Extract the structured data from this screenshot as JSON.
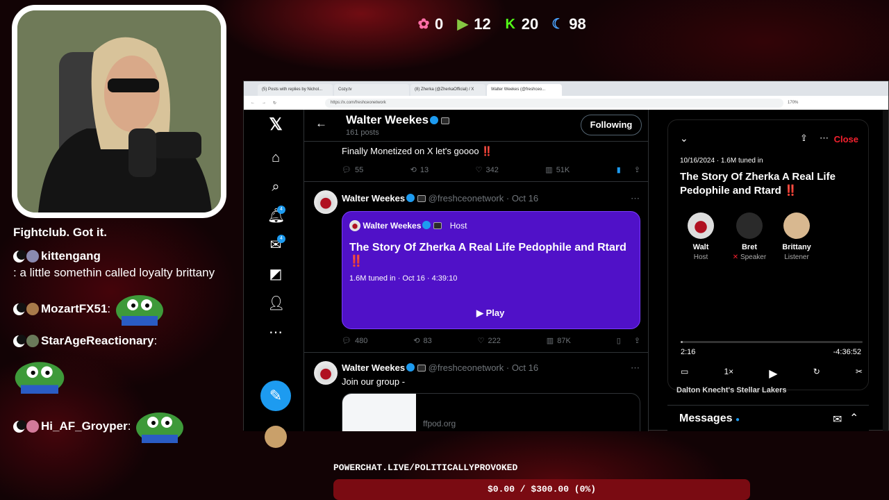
{
  "stream": {
    "counters": [
      {
        "icon": "flower-icon",
        "value": "0",
        "color": "#ff6fa8"
      },
      {
        "icon": "rumble-icon",
        "value": "12",
        "color": "#85c742"
      },
      {
        "icon": "kick-icon",
        "value": "20",
        "color": "#53fc18"
      },
      {
        "icon": "moon-icon",
        "value": "98",
        "color": "#4aa3ff"
      }
    ],
    "powerchat_label": "POWERCHAT.LIVE/POLITICALLYPROVOKED",
    "donation_text": "$0.00 / $300.00 (0%)",
    "donation_progress": 0
  },
  "chat": {
    "plain_message": "Fightclub. Got it.",
    "messages": [
      {
        "user": "kittengang",
        "text": ": a little somethin called loyalty brittany"
      },
      {
        "user": "MozartFX51",
        "text": ":"
      },
      {
        "user": "StarAgeReactionary",
        "text": ":"
      },
      {
        "user": "Hi_AF_Groyper",
        "text": ":"
      }
    ]
  },
  "browser": {
    "tabs": [
      "(5) Posts with replies by Nichol...",
      "Cozy.tv",
      "(8) Zherka (@ZherkaOfficial) / X",
      "Walter Weekes (@freshceo..."
    ],
    "url": "https://x.com/freshceonetwork",
    "zoom": "170%"
  },
  "profile": {
    "name": "Walter Weekes",
    "posts_count": "161 posts",
    "following_label": "Following"
  },
  "posts": [
    {
      "text": "Finally Monetized on X let's goooo ‼️",
      "replies": "55",
      "reposts": "13",
      "likes": "342",
      "views": "51K"
    },
    {
      "author": "Walter Weekes",
      "handle": "@freshceonetwork",
      "date": "· Oct 16",
      "space": {
        "host_name": "Walter Weekes",
        "host_label": "Host",
        "title": "The Story Of Zherka A Real Life Pedophile and Rtard ‼️",
        "tuned": "1.6M tuned in · Oct 16 · 4:39:10",
        "play_label": "Play"
      },
      "replies": "480",
      "reposts": "83",
      "likes": "222",
      "views": "87K"
    },
    {
      "author": "Walter Weekes",
      "handle": "@freshceonetwork",
      "date": "· Oct 16",
      "text": "Join our group -",
      "link_domain": "ffpod.org"
    }
  ],
  "space_panel": {
    "close_label": "Close",
    "date": "10/16/2024 · 1.6M tuned in",
    "title": "The Story Of Zherka A Real Life Pedophile and Rtard ‼️",
    "speakers": [
      {
        "name": "Walt",
        "role": "Host"
      },
      {
        "name": "Bret",
        "role": "Speaker"
      },
      {
        "name": "Brittany",
        "role": "Listener"
      }
    ],
    "elapsed": "2:16",
    "remaining": "-4:36:52",
    "progress": 0.008,
    "speed": "1×",
    "trend_text": "Dalton Knecht's Stellar Lakers",
    "messages_label": "Messages"
  },
  "nav_badges": {
    "notifications": "4",
    "messages": "4"
  }
}
